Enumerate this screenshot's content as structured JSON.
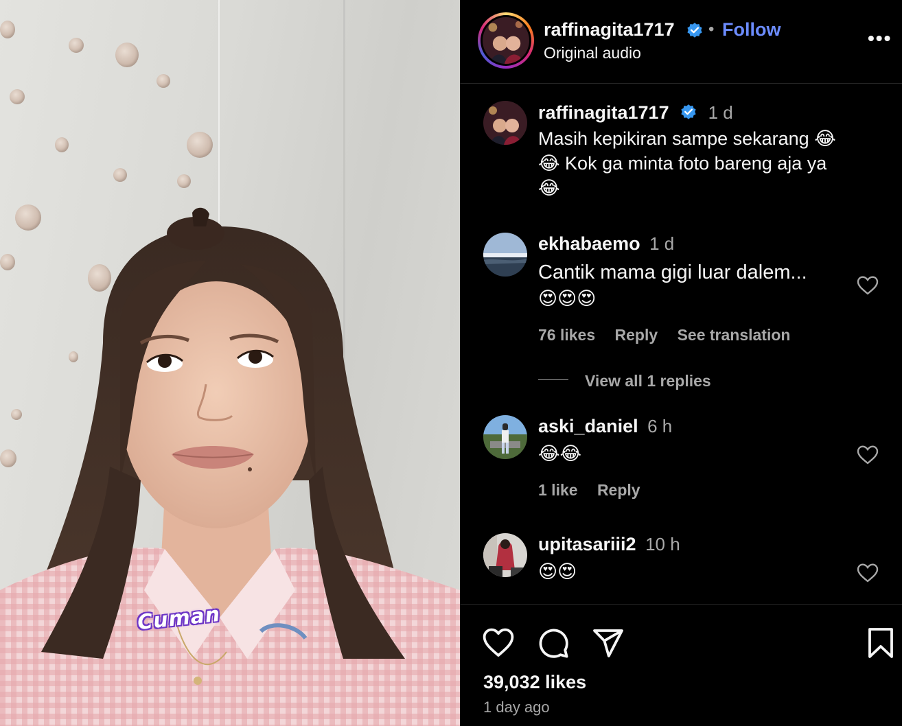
{
  "post": {
    "username": "raffinagita1717",
    "follow_label": "Follow",
    "separator": "•",
    "audio_label": "Original audio",
    "more_label": "•••",
    "media_caption": "Cuman"
  },
  "comments": [
    {
      "username": "raffinagita1717",
      "time": "1 d",
      "verified": true,
      "line1": "Masih kepikiran sampe sekarang 😂",
      "line2": "😂 Kok ga minta foto bareng aja ya",
      "line3": "😂"
    },
    {
      "username": "ekhabaemo",
      "time": "1 d",
      "line1": "Cantik mama gigi luar dalem...",
      "line2": "😍😍😍",
      "likes": "76 likes",
      "reply": "Reply",
      "translate": "See translation",
      "view_replies": "View all 1 replies"
    },
    {
      "username": "aski_daniel",
      "time": "6 h",
      "line1": "😂😂",
      "likes": "1 like",
      "reply": "Reply"
    },
    {
      "username": "upitasariii2",
      "time": "10 h",
      "line1": "😍😍"
    }
  ],
  "footer": {
    "likes": "39,032 likes",
    "posted": "1 day ago"
  },
  "colors": {
    "background": "#000000",
    "text": "#f5f5f5",
    "secondary": "#a8a8a8",
    "follow": "#6c8cff",
    "verified": "#3797f0"
  },
  "icons": [
    "verified-badge-icon",
    "more-icon",
    "heart-icon",
    "comment-icon",
    "share-icon",
    "bookmark-icon"
  ]
}
